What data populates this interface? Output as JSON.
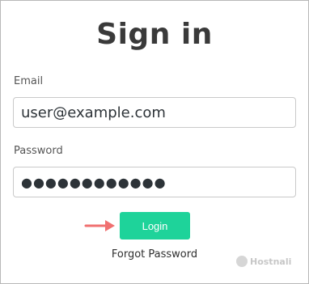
{
  "form": {
    "title": "Sign in",
    "email_label": "Email",
    "email_value": "user@example.com",
    "password_label": "Password",
    "password_value": "●●●●●●●●●●●●",
    "login_label": "Login",
    "forgot_label": "Forgot Password"
  },
  "watermark": {
    "text": "Hostnali"
  },
  "colors": {
    "login_button": "#1ed39a",
    "arrow": "#f07070"
  }
}
